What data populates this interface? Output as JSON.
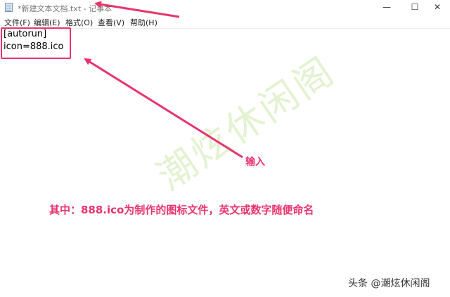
{
  "window": {
    "title": "*新建文本文档.txt - 记事本",
    "minimize_glyph": "—",
    "maximize_glyph": "☐",
    "close_glyph": "✕"
  },
  "menu": {
    "items": [
      "文件(F)",
      "编辑(E)",
      "格式(O)",
      "查看(V)",
      "帮助(H)"
    ]
  },
  "editor": {
    "lines": [
      "[autorun]",
      "icon=888.ico"
    ]
  },
  "annotations": {
    "input_label": "输入",
    "description": "其中：888.ico为制作的图标文件，英文或数字随便命名",
    "accent_color": "#e8336c"
  },
  "watermark": {
    "text": "潮炫休闲阁",
    "color": "#dff0c8"
  },
  "credit": {
    "text": "头条 @潮炫休闲阁"
  }
}
